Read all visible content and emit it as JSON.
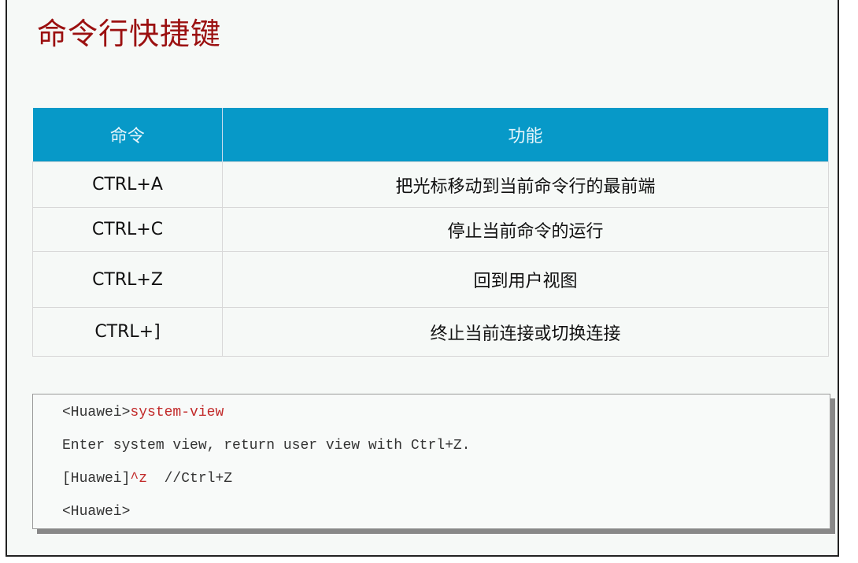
{
  "title": "命令行快捷键",
  "table": {
    "headers": [
      "命令",
      "功能"
    ],
    "rows": [
      {
        "command": "CTRL+A",
        "function": "把光标移动到当前命令行的最前端"
      },
      {
        "command": "CTRL+C",
        "function": "停止当前命令的运行"
      },
      {
        "command": "CTRL+Z",
        "function": "回到用户视图"
      },
      {
        "command": "CTRL+]",
        "function": "终止当前连接或切换连接"
      }
    ]
  },
  "code": {
    "line1_prompt": "<Huawei>",
    "line1_cmd": "system-view",
    "line2": "Enter system view, return user view with Ctrl+Z.",
    "line3_prompt": "[Huawei]",
    "line3_cmd": "^z",
    "line3_comment": "  //Ctrl+Z",
    "line4": "<Huawei>"
  },
  "colors": {
    "title": "#9b1010",
    "header": "#0799c8",
    "command": "#c22a2a"
  }
}
